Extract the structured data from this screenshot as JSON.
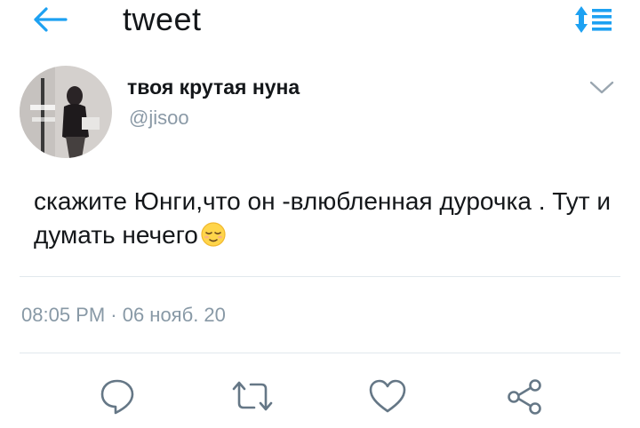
{
  "header": {
    "title": "tweet",
    "back_icon": "arrow-left-icon",
    "menu_icon": "sort-list-icon",
    "accent_color": "#1da1f2"
  },
  "tweet": {
    "author_name": "твоя крутая нуна",
    "handle": "@jisoo",
    "text": "скажите Юнги,что он -влюбленная дурочка . Тут и думать нечего",
    "emoji": "relieved-face-emoji",
    "timestamp": "08:05 PM · 06 нояб. 20"
  },
  "actions": {
    "reply_icon": "reply-icon",
    "retweet_icon": "retweet-icon",
    "like_icon": "heart-icon",
    "share_icon": "share-icon"
  }
}
